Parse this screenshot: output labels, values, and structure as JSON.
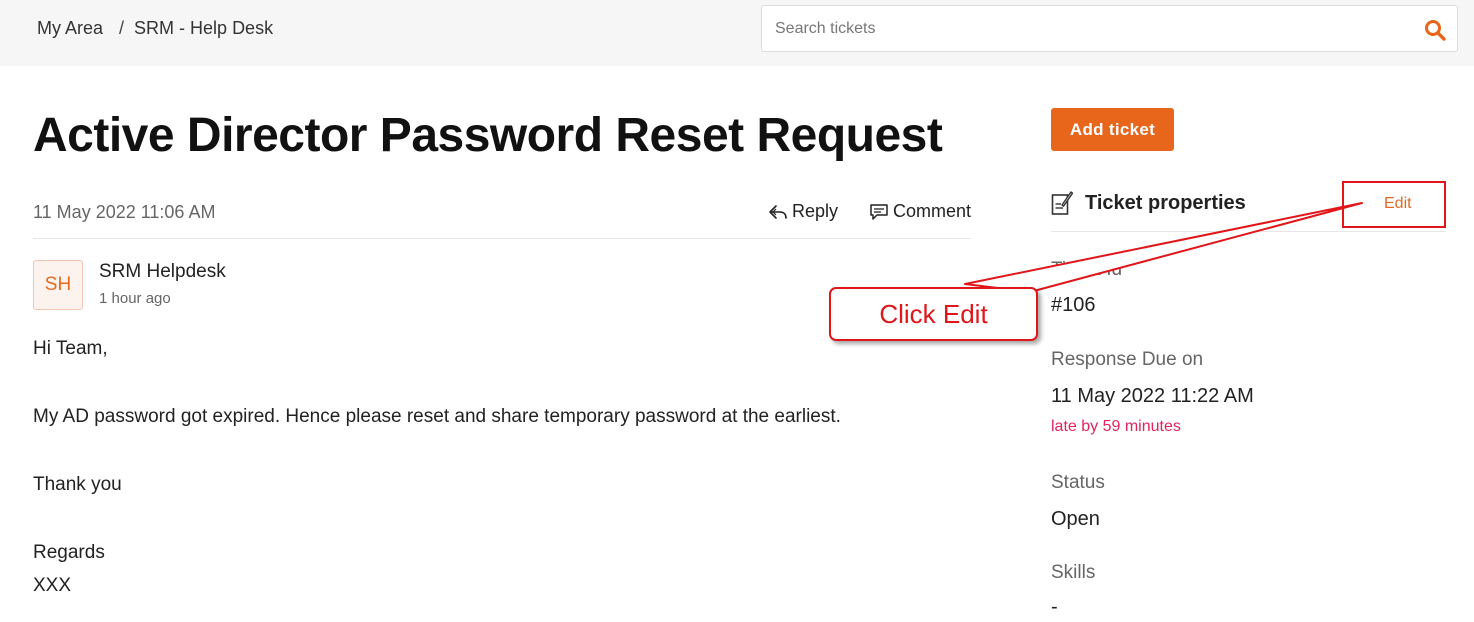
{
  "breadcrumb": {
    "home": "My Area",
    "separator": "/",
    "current": "SRM - Help Desk"
  },
  "search": {
    "placeholder": "Search tickets",
    "icon": "search-icon"
  },
  "ticket": {
    "title": "Active Director Password Reset Request",
    "date": "11 May 2022 11:06 AM",
    "reply_label": "Reply",
    "comment_label": "Comment"
  },
  "message": {
    "avatar_initials": "SH",
    "author": "SRM Helpdesk",
    "time": "1 hour ago",
    "lines": [
      "Hi Team,",
      "My AD password got expired. Hence please reset and share temporary password at the earliest.",
      "Thank you",
      "Regards",
      "XXX"
    ]
  },
  "sidebar": {
    "add_ticket_label": "Add ticket",
    "properties_title": "Ticket properties",
    "edit_label": "Edit",
    "ticket_id_label": "Ticket Id",
    "ticket_id_value": "#106",
    "response_due_label": "Response Due on",
    "response_due_value": "11 May 2022 11:22 AM",
    "late_text": "late by 59 minutes",
    "status_label": "Status",
    "status_value": "Open",
    "skills_label": "Skills",
    "skills_value": "-"
  },
  "annotation": {
    "callout_text": "Click Edit"
  },
  "colors": {
    "accent": "#e8661b",
    "annotation_red": "#e0161b",
    "late_red": "#e0245e"
  }
}
